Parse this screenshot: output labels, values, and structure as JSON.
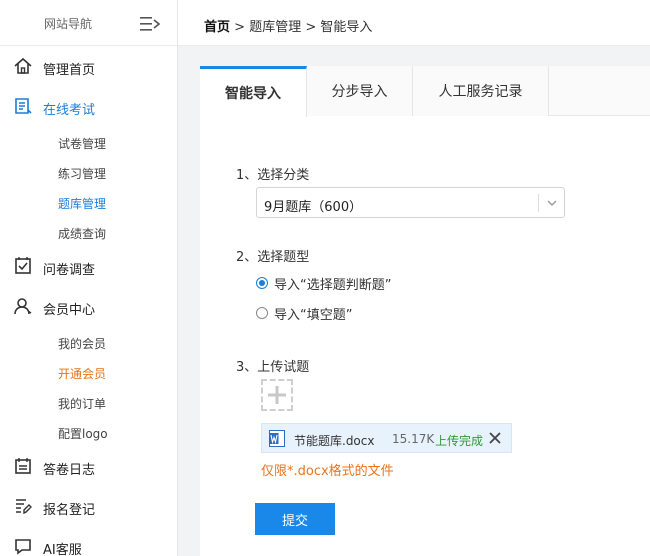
{
  "sidebar": {
    "title": "网站导航",
    "items": [
      {
        "label": "管理首页"
      },
      {
        "label": "在线考试"
      },
      {
        "label": "问卷调查"
      },
      {
        "label": "会员中心"
      },
      {
        "label": "答卷日志"
      },
      {
        "label": "报名登记"
      },
      {
        "label": "AI客服"
      }
    ],
    "exam_sub": [
      "试卷管理",
      "练习管理",
      "题库管理",
      "成绩查询"
    ],
    "member_sub": [
      "我的会员",
      "开通会员",
      "我的订单",
      "配置logo"
    ]
  },
  "breadcrumb": {
    "home": "首页",
    "sep1": ">",
    "level1": "题库管理",
    "sep2": ">",
    "current": "智能导入"
  },
  "tabs": [
    "智能导入",
    "分步导入",
    "人工服务记录"
  ],
  "form": {
    "step1_label": "1、选择分类",
    "category_value": "9月题库（600）",
    "step2_label": "2、选择题型",
    "option1": "导入“选择题判断题”",
    "option2": "导入“填空题”",
    "step3_label": "3、上传试题",
    "file_name": "节能题库.docx",
    "file_size": "15.17K",
    "file_status": "上传完成",
    "hint": "仅限*.docx格式的文件",
    "submit_label": "提交"
  },
  "colors": {
    "accent": "#1a88e8",
    "warning": "#e8741b",
    "success": "#2e9b32"
  }
}
